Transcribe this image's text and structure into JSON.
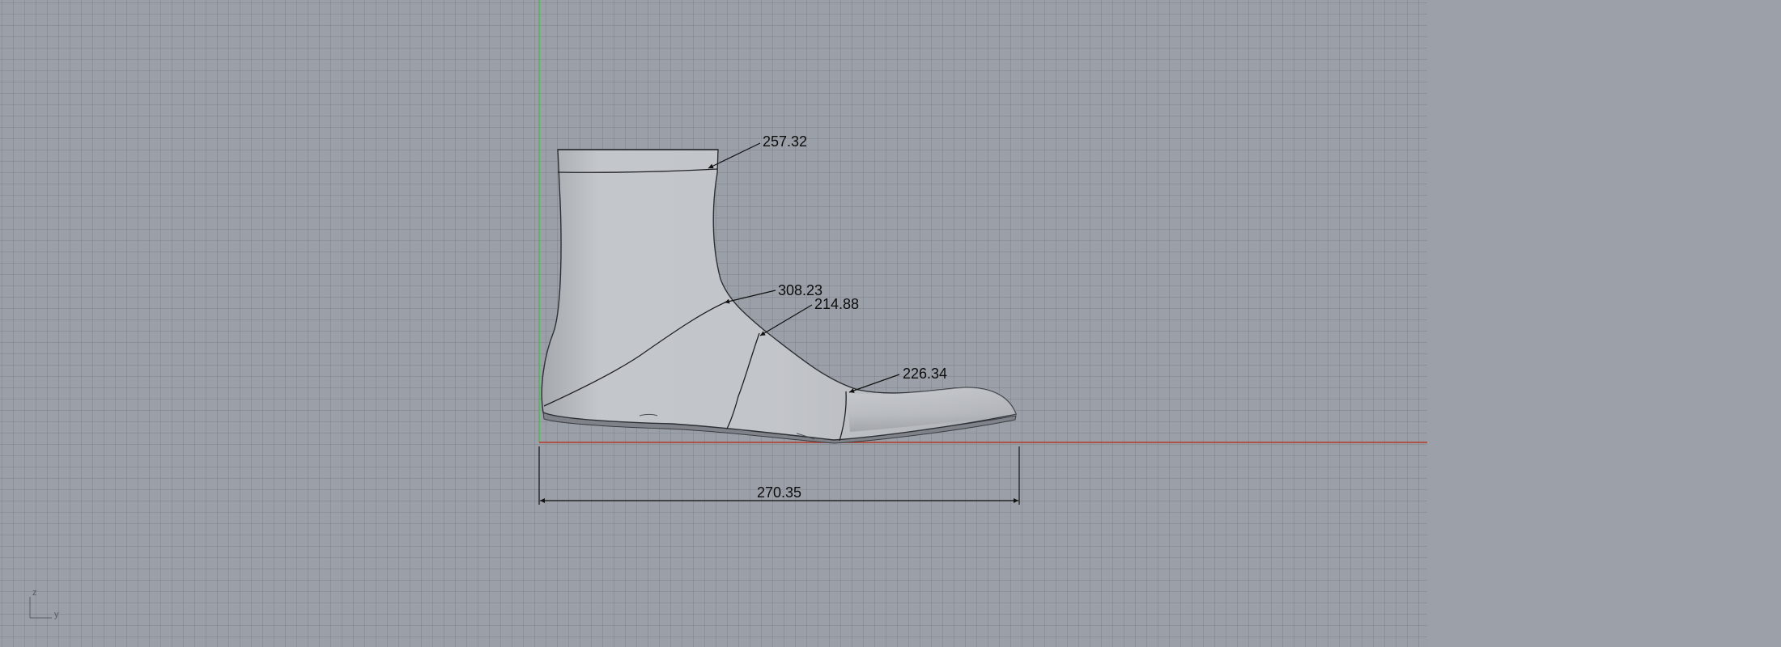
{
  "viewport": {
    "name": "Right",
    "axis_colors": {
      "x_axis": "#b33a2a",
      "z_axis": "#4db84d"
    },
    "grid": true
  },
  "dimensions": [
    {
      "id": "ankle-girth",
      "label": "257.32"
    },
    {
      "id": "instep-girth",
      "label": "308.23"
    },
    {
      "id": "waist-girth",
      "label": "214.88"
    },
    {
      "id": "ball-girth",
      "label": "226.34"
    },
    {
      "id": "length",
      "label": "270.35"
    }
  ],
  "axis_widget": {
    "vertical": "z",
    "horizontal": "y"
  }
}
